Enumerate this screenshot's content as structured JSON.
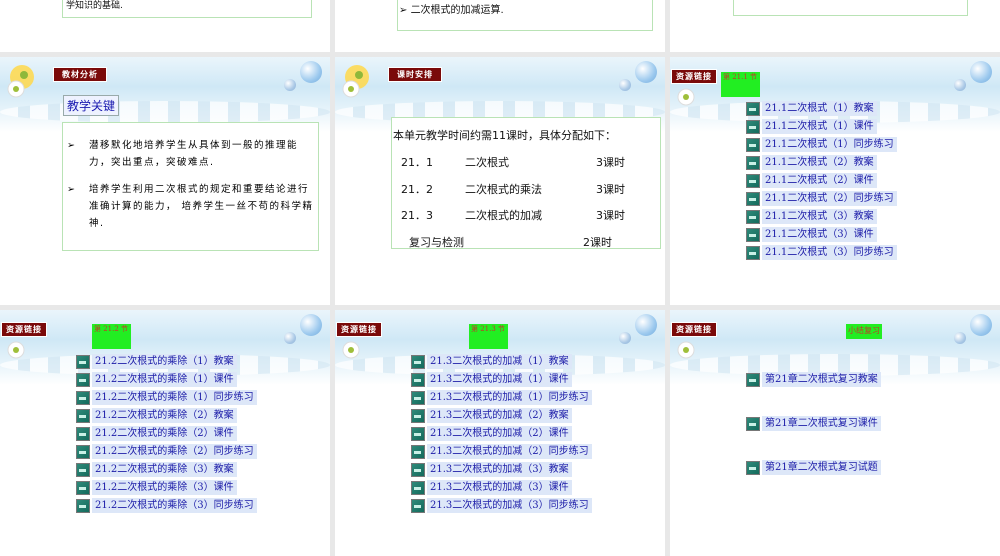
{
  "top_row": {
    "left_text": "学知识的基础.",
    "middle_text": "二次根式的加减运算."
  },
  "slide_analysis": {
    "tab": "教材分析",
    "heading": "教学关键",
    "bullets": [
      "潜移默化地培养学生从具体到一般的推理能力，突出重点，突破难点.",
      "培养学生利用二次根式的规定和重要结论进行准确计算的能力， 培养学生一丝不苟的科学精神."
    ]
  },
  "slide_schedule": {
    "tab": "课时安排",
    "intro": "本单元教学时间约需11课时，具体分配如下：",
    "rows": [
      {
        "num": "21．1",
        "name": "二次根式",
        "hours": "3课时"
      },
      {
        "num": "21．2",
        "name": "二次根式的乘法",
        "hours": "3课时"
      },
      {
        "num": "21．3",
        "name": "二次根式的加减",
        "hours": "3课时"
      },
      {
        "num": "",
        "name": "复习与检测",
        "hours": "2课时"
      }
    ]
  },
  "slide_links_211": {
    "tab": "资源链接",
    "section": "第 21.1 节",
    "links": [
      "21.1二次根式（1）教案",
      "21.1二次根式（1）课件",
      "21.1二次根式（1）同步练习",
      "21.1二次根式（2）教案",
      "21.1二次根式（2）课件",
      "21.1二次根式（2）同步练习",
      "21.1二次根式（3）教案",
      "21.1二次根式（3）课件",
      "21.1二次根式（3）同步练习"
    ]
  },
  "slide_links_212": {
    "tab": "资源链接",
    "section": "第 21.2 节",
    "links": [
      "21.2二次根式的乘除（1）教案",
      "21.2二次根式的乘除（1）课件",
      "21.2二次根式的乘除（1）同步练习",
      "21.2二次根式的乘除（2）教案",
      "21.2二次根式的乘除（2）课件",
      "21.2二次根式的乘除（2）同步练习",
      "21.2二次根式的乘除（3）教案",
      "21.2二次根式的乘除（3）课件",
      "21.2二次根式的乘除（3）同步练习"
    ]
  },
  "slide_links_213": {
    "tab": "资源链接",
    "section": "第 21.3 节",
    "links": [
      "21.3二次根式的加减（1）教案",
      "21.3二次根式的加减（1）课件",
      "21.3二次根式的加减（1）同步练习",
      "21.3二次根式的加减（2）教案",
      "21.3二次根式的加减（2）课件",
      "21.3二次根式的加减（2）同步练习",
      "21.3二次根式的加减（3）教案",
      "21.3二次根式的加减（3）课件",
      "21.3二次根式的加减（3）同步练习"
    ]
  },
  "slide_review": {
    "tab": "资源链接",
    "section": "小结复习",
    "links": [
      "第21章二次根式复习教案",
      "第21章二次根式复习课件",
      "第21章二次根式复习试题"
    ]
  }
}
